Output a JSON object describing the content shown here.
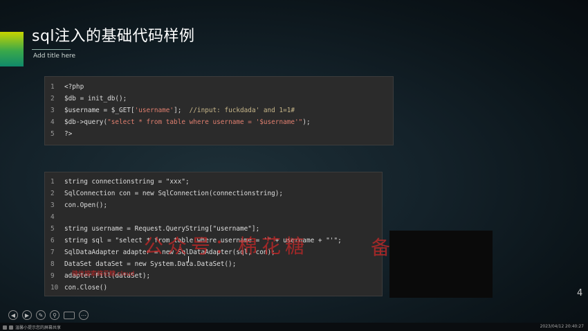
{
  "slide": {
    "title": "sql注入的基础代码样例",
    "subtitle": "Add title here",
    "page_number": "4"
  },
  "code_block_1": [
    {
      "n": "1",
      "text": "<?php"
    },
    {
      "n": "2",
      "text": "$db = init_db();"
    },
    {
      "n": "3",
      "pre": "$username = $_GET[",
      "str": "'username'",
      "mid": "];  ",
      "cmt": "//input: fuckdada' and 1=1#"
    },
    {
      "n": "4",
      "pre": "$db->query(",
      "str": "\"select * from table where username = '$username'\"",
      "mid": ");"
    },
    {
      "n": "5",
      "text": "?>"
    }
  ],
  "code_block_2": [
    {
      "n": "1",
      "text": "string connectionstring = \"xxx\";"
    },
    {
      "n": "2",
      "text": "SqlConnection con = new SqlConnection(connectionstring);"
    },
    {
      "n": "3",
      "text": "con.Open();"
    },
    {
      "n": "4",
      "text": ""
    },
    {
      "n": "5",
      "text": "string username = Request.QueryString[\"username\"];"
    },
    {
      "n": "6",
      "text": "string sql = \"select * from table where username = '\" + username + \"'\";"
    },
    {
      "n": "7",
      "text": "SqlDataAdapter adapter = new SqlDataAdapter(sql, con);"
    },
    {
      "n": "8",
      "text": "DataSet dataSet = new System.Data.DataSet();"
    },
    {
      "n": "9",
      "text": "adapter.Fill(dataSet);"
    },
    {
      "n": "10",
      "text": "con.Close()"
    }
  ],
  "overlay": {
    "watermark": "公众号：棉花糖",
    "watermark_right": "备",
    "small_red_text": "微信搜索棉花糖.cloud"
  },
  "player_controls": {
    "icons": [
      "prev-icon",
      "next-icon",
      "pen-icon",
      "search-icon",
      "screen-icon",
      "more-icon"
    ]
  },
  "taskbar": {
    "left_text": "温馨小提示您的屏幕共享",
    "datetime": "2023/04/12 20:40:27"
  }
}
